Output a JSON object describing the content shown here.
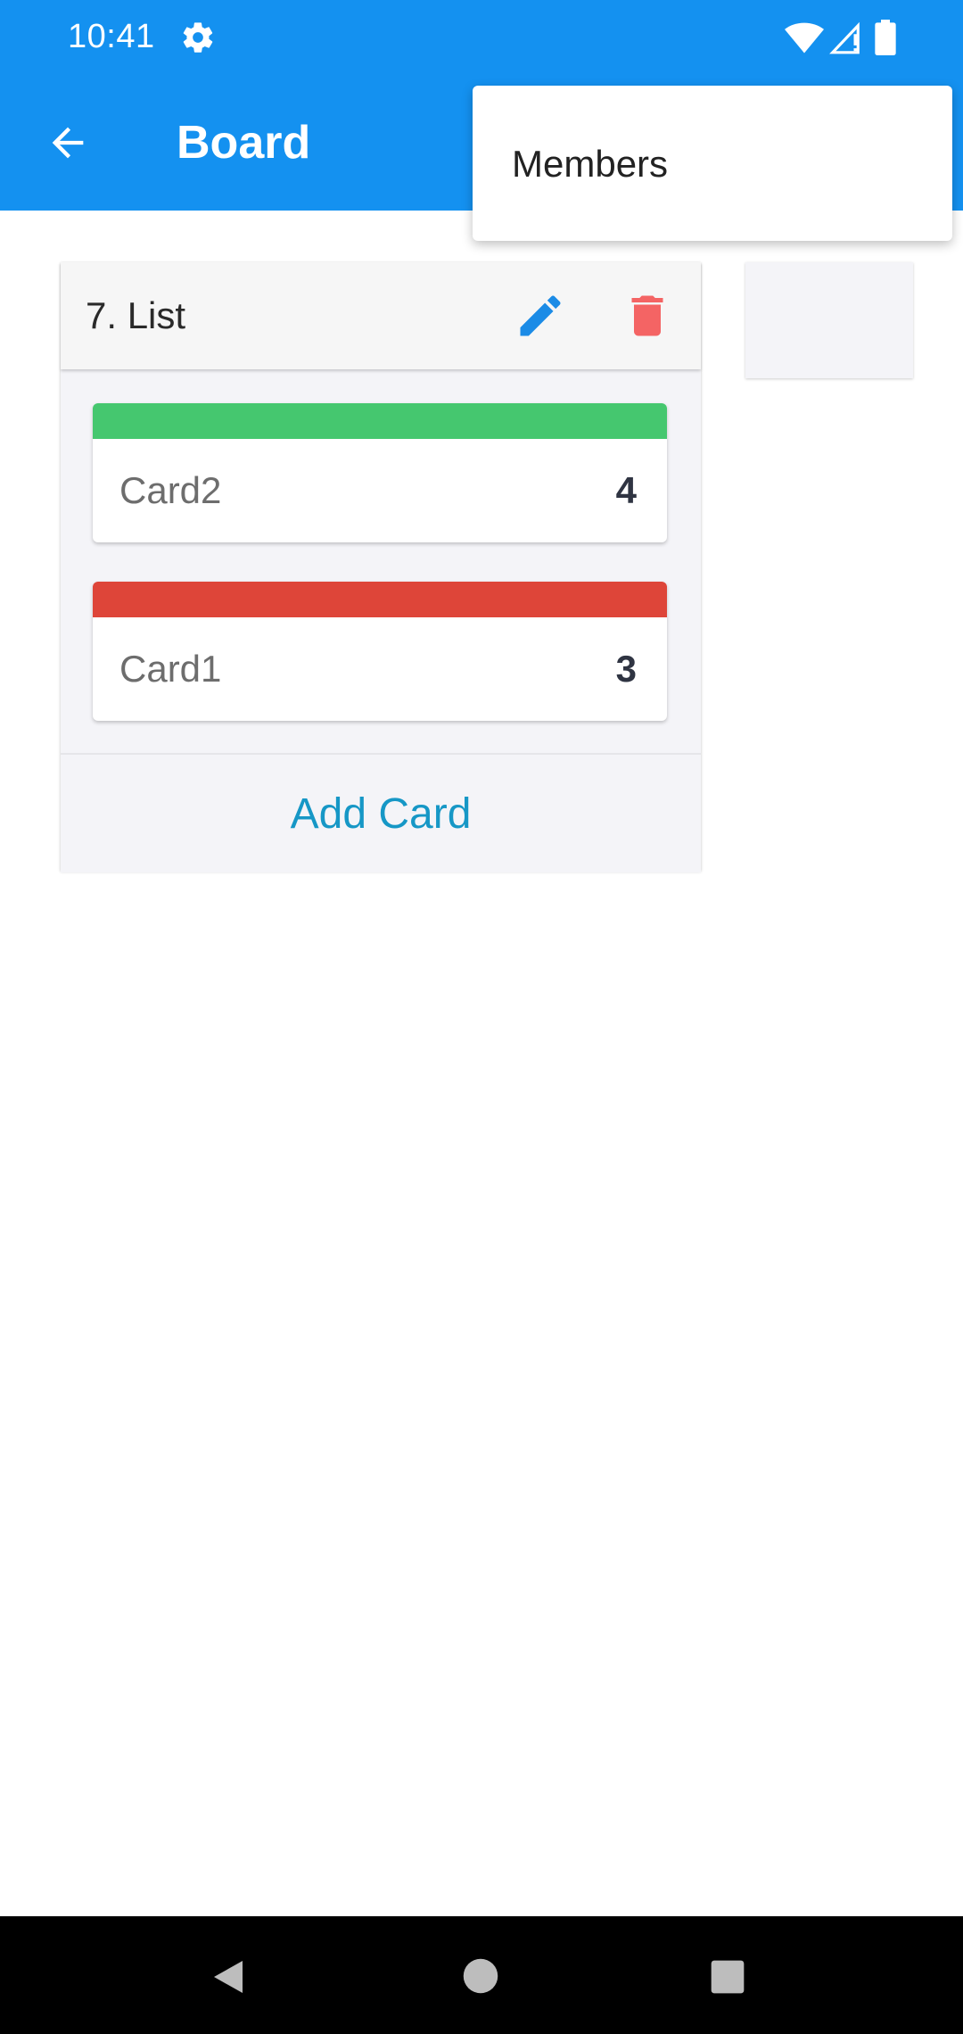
{
  "status_bar": {
    "time": "10:41",
    "icons": [
      "gear-icon",
      "wifi-icon",
      "signal-icon",
      "battery-icon"
    ]
  },
  "app_bar": {
    "title": "Board",
    "back_icon": "arrow-back-icon",
    "color": "#1491f0"
  },
  "overflow_menu": {
    "items": [
      {
        "label": "Members"
      }
    ]
  },
  "lists": [
    {
      "title": "7. List",
      "edit_icon": "pencil-icon",
      "delete_icon": "trash-icon",
      "cards": [
        {
          "name": "Card2",
          "count": "4",
          "stripe_color": "#45c76f"
        },
        {
          "name": "Card1",
          "count": "3",
          "stripe_color": "#de4539"
        }
      ],
      "add_card_label": "Add Card"
    }
  ],
  "colors": {
    "edit": "#1b8be6",
    "delete": "#f46464",
    "add_card_text": "#1697c6"
  },
  "nav_bar": {
    "icons": [
      "nav-back-icon",
      "nav-home-icon",
      "nav-recents-icon"
    ]
  }
}
